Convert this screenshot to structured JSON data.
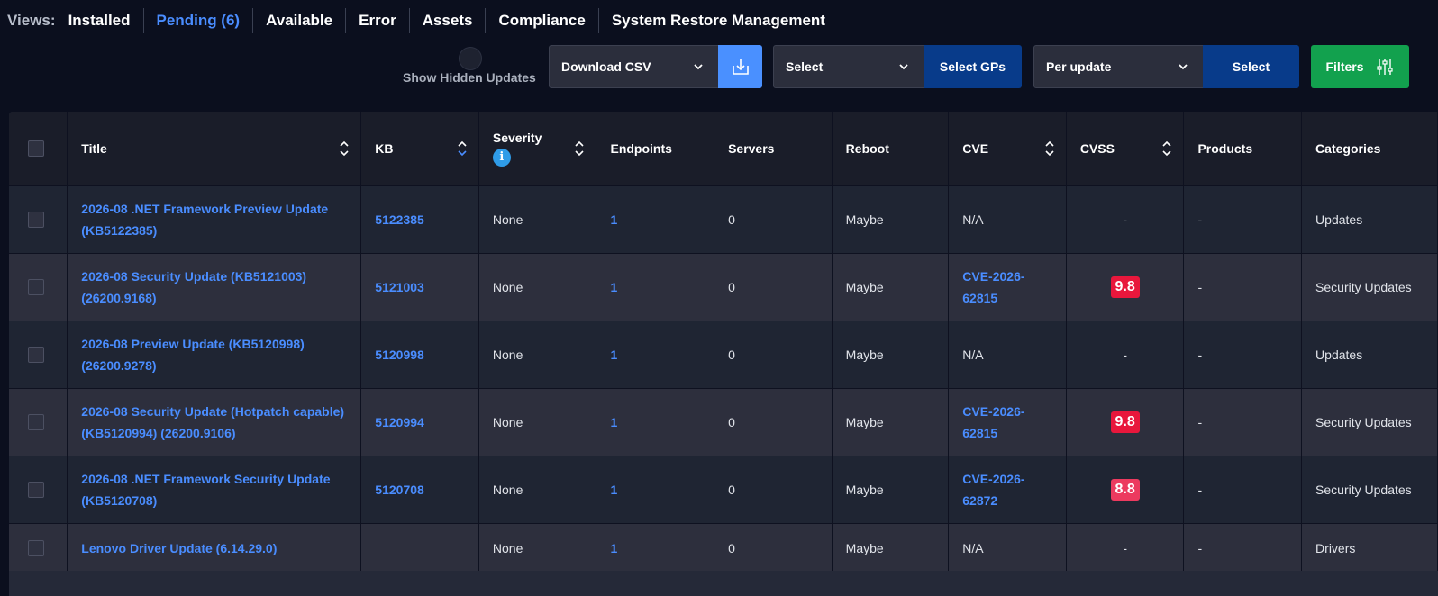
{
  "views": {
    "label": "Views:",
    "tabs": [
      {
        "label": "Installed",
        "active": false
      },
      {
        "label": "Pending (6)",
        "active": true
      },
      {
        "label": "Available",
        "active": false
      },
      {
        "label": "Error",
        "active": false
      },
      {
        "label": "Assets",
        "active": false
      },
      {
        "label": "Compliance",
        "active": false
      },
      {
        "label": "System Restore Management",
        "active": false
      }
    ]
  },
  "toolbar": {
    "show_hidden_label": "Show Hidden Updates",
    "download_select": "Download CSV",
    "gp_select": "Select",
    "gp_button": "Select GPs",
    "per_select": "Per update",
    "per_button": "Select",
    "filters_button": "Filters"
  },
  "colors": {
    "accent": "#4a8dff",
    "cvss_critical": "#e8173c",
    "cvss_high": "#ec3a5f",
    "filters": "#12a14e"
  },
  "table": {
    "headers": {
      "title": "Title",
      "kb": "KB",
      "severity": "Severity",
      "endpoints": "Endpoints",
      "servers": "Servers",
      "reboot": "Reboot",
      "cve": "CVE",
      "cvss": "CVSS",
      "products": "Products",
      "categories": "Categories"
    },
    "rows": [
      {
        "title": "2026-08 .NET Framework Preview Update (KB5122385)",
        "kb": "5122385",
        "severity": "None",
        "endpoints": "1",
        "servers": "0",
        "reboot": "Maybe",
        "cve": "N/A",
        "cve_link": false,
        "cvss": "-",
        "products": "-",
        "categories": "Updates"
      },
      {
        "title": "2026-08 Security Update (KB5121003) (26200.9168)",
        "kb": "5121003",
        "severity": "None",
        "endpoints": "1",
        "servers": "0",
        "reboot": "Maybe",
        "cve": "CVE-2026-62815",
        "cve_link": true,
        "cvss": "9.8",
        "products": "-",
        "categories": "Security Updates"
      },
      {
        "title": "2026-08 Preview Update (KB5120998) (26200.9278)",
        "kb": "5120998",
        "severity": "None",
        "endpoints": "1",
        "servers": "0",
        "reboot": "Maybe",
        "cve": "N/A",
        "cve_link": false,
        "cvss": "-",
        "products": "-",
        "categories": "Updates"
      },
      {
        "title": "2026-08 Security Update (Hotpatch capable) (KB5120994) (26200.9106)",
        "kb": "5120994",
        "severity": "None",
        "endpoints": "1",
        "servers": "0",
        "reboot": "Maybe",
        "cve": "CVE-2026-62815",
        "cve_link": true,
        "cvss": "9.8",
        "products": "-",
        "categories": "Security Updates"
      },
      {
        "title": "2026-08 .NET Framework Security Update (KB5120708)",
        "kb": "5120708",
        "severity": "None",
        "endpoints": "1",
        "servers": "0",
        "reboot": "Maybe",
        "cve": "CVE-2026-62872",
        "cve_link": true,
        "cvss": "8.8",
        "products": "-",
        "categories": "Security Updates"
      },
      {
        "title": "Lenovo Driver Update (6.14.29.0)",
        "kb": "",
        "severity": "None",
        "endpoints": "1",
        "servers": "0",
        "reboot": "Maybe",
        "cve": "N/A",
        "cve_link": false,
        "cvss": "-",
        "products": "-",
        "categories": "Drivers"
      }
    ]
  }
}
